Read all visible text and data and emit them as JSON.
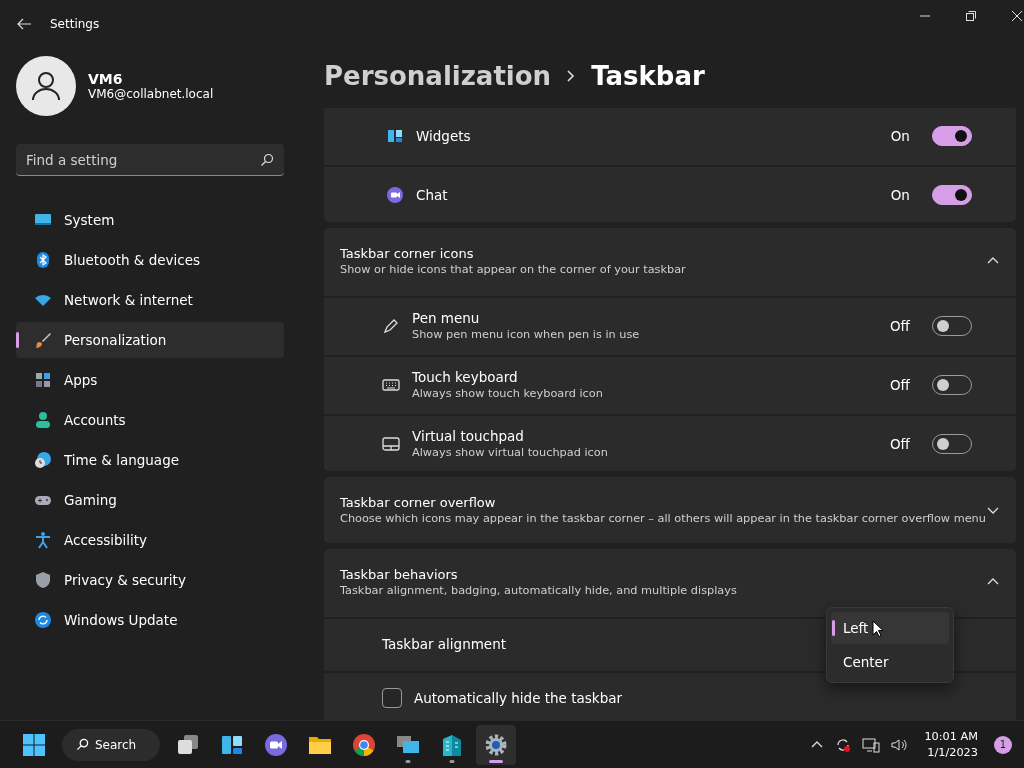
{
  "window": {
    "title": "Settings"
  },
  "user": {
    "name": "VM6",
    "email": "VM6@collabnet.local"
  },
  "search": {
    "placeholder": "Find a setting"
  },
  "nav": [
    {
      "label": "System",
      "selected": false
    },
    {
      "label": "Bluetooth & devices",
      "selected": false
    },
    {
      "label": "Network & internet",
      "selected": false
    },
    {
      "label": "Personalization",
      "selected": true
    },
    {
      "label": "Apps",
      "selected": false
    },
    {
      "label": "Accounts",
      "selected": false
    },
    {
      "label": "Time & language",
      "selected": false
    },
    {
      "label": "Gaming",
      "selected": false
    },
    {
      "label": "Accessibility",
      "selected": false
    },
    {
      "label": "Privacy & security",
      "selected": false
    },
    {
      "label": "Windows Update",
      "selected": false
    }
  ],
  "breadcrumb": [
    "Personalization",
    "Taskbar"
  ],
  "cards": [
    {
      "kind": "list",
      "rows": [
        {
          "kind": "toggle",
          "label": "Widgets",
          "status": "On",
          "on": true
        },
        {
          "kind": "toggle",
          "label": "Chat",
          "status": "On",
          "on": true
        }
      ]
    },
    {
      "kind": "group",
      "title": "Taskbar corner icons",
      "subtitle": "Show or hide icons that appear on the corner of your taskbar",
      "expanded": true,
      "rows": [
        {
          "kind": "toggle",
          "label": "Pen menu",
          "description": "Show pen menu icon when pen is in use",
          "status": "Off",
          "on": false
        },
        {
          "kind": "toggle",
          "label": "Touch keyboard",
          "description": "Always show touch keyboard icon",
          "status": "Off",
          "on": false
        },
        {
          "kind": "toggle",
          "label": "Virtual touchpad",
          "description": "Always show virtual touchpad icon",
          "status": "Off",
          "on": false
        }
      ]
    },
    {
      "kind": "group",
      "title": "Taskbar corner overflow",
      "subtitle": "Choose which icons may appear in the taskbar corner – all others will appear in the taskbar corner overflow menu",
      "expanded": false
    },
    {
      "kind": "group",
      "title": "Taskbar behaviors",
      "subtitle": "Taskbar alignment, badging, automatically hide, and multiple displays",
      "expanded": true,
      "rows": [
        {
          "kind": "select",
          "label": "Taskbar alignment",
          "options": [
            {
              "label": "Left",
              "selected": true
            },
            {
              "label": "Center",
              "selected": false
            }
          ]
        },
        {
          "kind": "checkbox",
          "label": "Automatically hide the taskbar",
          "checked": false
        }
      ]
    }
  ],
  "taskbar": {
    "search": "Search",
    "apps": [
      {
        "running": false,
        "selected": false
      },
      {
        "running": false,
        "selected": false
      },
      {
        "running": false,
        "selected": false
      },
      {
        "running": false,
        "selected": false
      },
      {
        "running": false,
        "selected": false
      },
      {
        "running": false,
        "selected": false
      },
      {
        "running": true,
        "selected": false
      },
      {
        "running": true,
        "selected": false
      },
      {
        "running": true,
        "selected": true
      }
    ],
    "time": "10:01 AM",
    "date": "1/1/2023",
    "notifications": "1"
  }
}
